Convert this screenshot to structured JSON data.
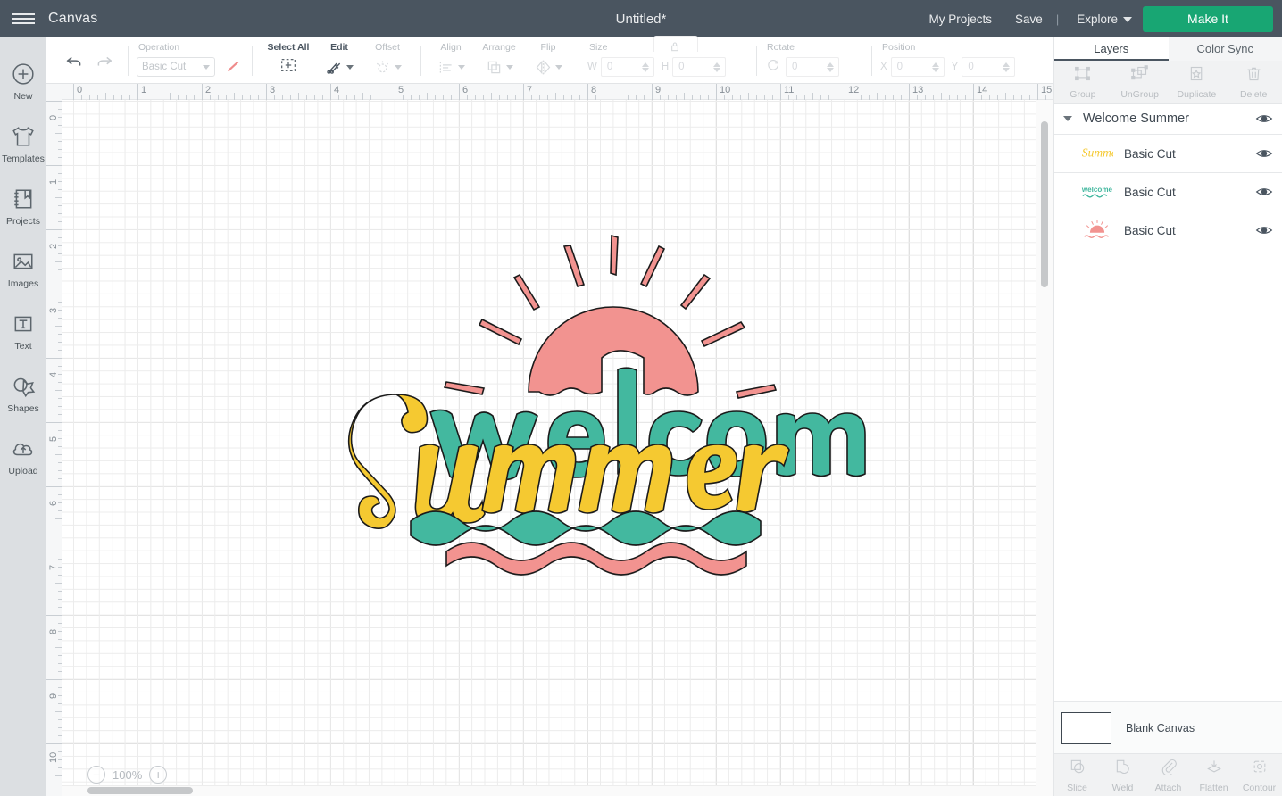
{
  "header": {
    "menu_icon": "hamburger-icon",
    "canvas_label": "Canvas",
    "document_title": "Untitled*",
    "my_projects": "My Projects",
    "save": "Save",
    "divider": "|",
    "explore": "Explore",
    "explore_chevron": "chevron-down-icon",
    "make_it": "Make It",
    "bg_color": "#4a5560",
    "make_it_color": "#18a673"
  },
  "rail": {
    "items": [
      {
        "label": "New",
        "icon": "plus-circle-icon"
      },
      {
        "label": "Templates",
        "icon": "tshirt-icon"
      },
      {
        "label": "Projects",
        "icon": "bookmark-book-icon"
      },
      {
        "label": "Images",
        "icon": "picture-icon"
      },
      {
        "label": "Text",
        "icon": "text-t-icon"
      },
      {
        "label": "Shapes",
        "icon": "star-shape-icon"
      },
      {
        "label": "Upload",
        "icon": "upload-cloud-icon"
      }
    ]
  },
  "toolbar": {
    "undo_icon": "undo-arrow-icon",
    "redo_icon": "redo-arrow-icon",
    "operation_label": "Operation",
    "operation_value": "Basic Cut",
    "stroke_icon": "line-stroke-icon",
    "select_all_label": "Select All",
    "select_all_icon": "marquee-plus-icon",
    "edit_label": "Edit",
    "edit_icon": "scissors-pencil-icon",
    "offset_label": "Offset",
    "offset_icon": "offset-glow-icon",
    "align_label": "Align",
    "align_icon": "align-left-icon",
    "arrange_label": "Arrange",
    "arrange_icon": "layers-stack-icon",
    "flip_label": "Flip",
    "flip_icon": "flip-horizontal-icon",
    "size_label": "Size",
    "lock_icon": "lock-icon",
    "width_label": "W",
    "width_value": "0",
    "height_label": "H",
    "height_value": "0",
    "rotate_label": "Rotate",
    "rotate_icon": "rotate-icon",
    "rotate_value": "0",
    "position_label": "Position",
    "x_label": "X",
    "x_value": "0",
    "y_label": "Y",
    "y_value": "0"
  },
  "canvas": {
    "h_ruler_ticks": [
      "0",
      "1",
      "2",
      "3",
      "4",
      "5",
      "6",
      "7",
      "8",
      "9",
      "10",
      "11",
      "12",
      "13",
      "14",
      "15"
    ],
    "v_ruler_ticks": [
      "0",
      "1",
      "2",
      "3",
      "4",
      "5",
      "6",
      "7",
      "8",
      "9",
      "10"
    ],
    "zoom_out_icon": "minus-circle-icon",
    "zoom_level": "100%",
    "zoom_in_icon": "plus-circle-icon",
    "artwork": {
      "title": "Welcome Summer",
      "script_text": "Summer",
      "sans_text": "welcome",
      "colors": {
        "coral": "#F29390",
        "teal": "#43B89F",
        "yellow": "#F5C931",
        "outline": "#1b1b1b"
      }
    }
  },
  "panel": {
    "tabs": [
      {
        "label": "Layers",
        "active": true
      },
      {
        "label": "Color Sync",
        "active": false
      }
    ],
    "layer_tools": [
      {
        "label": "Group",
        "icon": "group-icon"
      },
      {
        "label": "UnGroup",
        "icon": "ungroup-icon"
      },
      {
        "label": "Duplicate",
        "icon": "duplicate-icon"
      },
      {
        "label": "Delete",
        "icon": "trash-icon"
      }
    ],
    "group": {
      "collapse_icon": "triangle-down-icon",
      "name": "Welcome Summer",
      "visibility_icon": "eye-icon"
    },
    "layers": [
      {
        "name": "Basic Cut",
        "thumb": "summer-script-thumb",
        "visibility_icon": "eye-icon"
      },
      {
        "name": "Basic Cut",
        "thumb": "welcome-word-thumb",
        "visibility_icon": "eye-icon"
      },
      {
        "name": "Basic Cut",
        "thumb": "sunburst-thumb",
        "visibility_icon": "eye-icon"
      }
    ],
    "blank_canvas": {
      "label": "Blank Canvas",
      "swatch_color": "#ffffff"
    },
    "operations": [
      {
        "label": "Slice",
        "icon": "slice-icon"
      },
      {
        "label": "Weld",
        "icon": "weld-icon"
      },
      {
        "label": "Attach",
        "icon": "paperclip-icon"
      },
      {
        "label": "Flatten",
        "icon": "flatten-icon"
      },
      {
        "label": "Contour",
        "icon": "contour-icon"
      }
    ]
  }
}
